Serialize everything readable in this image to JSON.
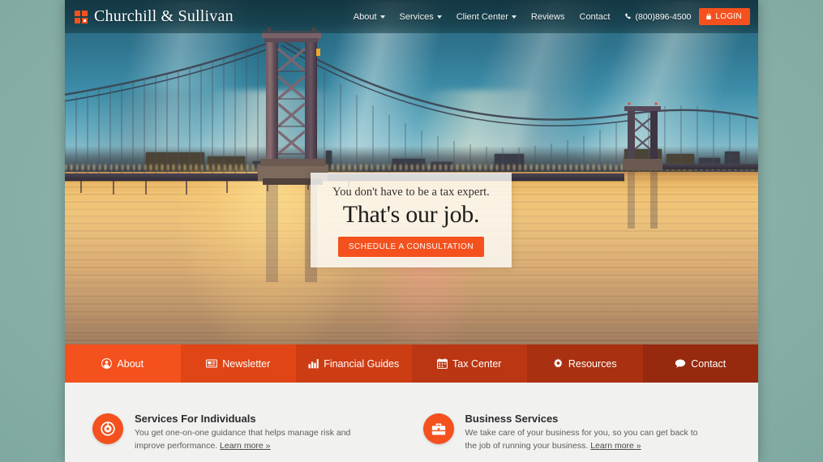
{
  "brand": {
    "name": "Churchill & Sullivan",
    "logo_icon": "four-squares-logo-icon",
    "accent_color": "#f4511e"
  },
  "header": {
    "nav": [
      {
        "label": "About",
        "has_dropdown": true
      },
      {
        "label": "Services",
        "has_dropdown": true
      },
      {
        "label": "Client Center",
        "has_dropdown": true
      },
      {
        "label": "Reviews",
        "has_dropdown": false
      },
      {
        "label": "Contact",
        "has_dropdown": false
      }
    ],
    "phone": "(800)896-4500",
    "phone_icon": "phone-icon",
    "login_label": "LOGIN",
    "login_icon": "lock-icon"
  },
  "hero": {
    "kicker": "You don't have to be a tax expert.",
    "title": "That's our job.",
    "cta_label": "SCHEDULE A CONSULTATION",
    "image_alt": "Benjamin Franklin Bridge at sunset over river"
  },
  "iconnav": [
    {
      "label": "About",
      "icon": "user-circle-icon",
      "bg": "#f4511e"
    },
    {
      "label": "Newsletter",
      "icon": "newspaper-icon",
      "bg": "#e04516"
    },
    {
      "label": "Financial Guides",
      "icon": "bar-chart-icon",
      "bg": "#cd3d14"
    },
    {
      "label": "Tax Center",
      "icon": "calendar-icon",
      "bg": "#bb3612"
    },
    {
      "label": "Resources",
      "icon": "gear-icon",
      "bg": "#a93010"
    },
    {
      "label": "Contact",
      "icon": "comment-icon",
      "bg": "#96290e"
    }
  ],
  "services": [
    {
      "title": "Services For Individuals",
      "icon": "target-circle-icon",
      "text": "You get one-on-one guidance that helps manage risk and improve performance. ",
      "link_label": "Learn more »"
    },
    {
      "title": "Business Services",
      "icon": "briefcase-icon",
      "text": "We take care of your business for you, so you can get back to the job of running your business. ",
      "link_label": "Learn more »"
    }
  ]
}
